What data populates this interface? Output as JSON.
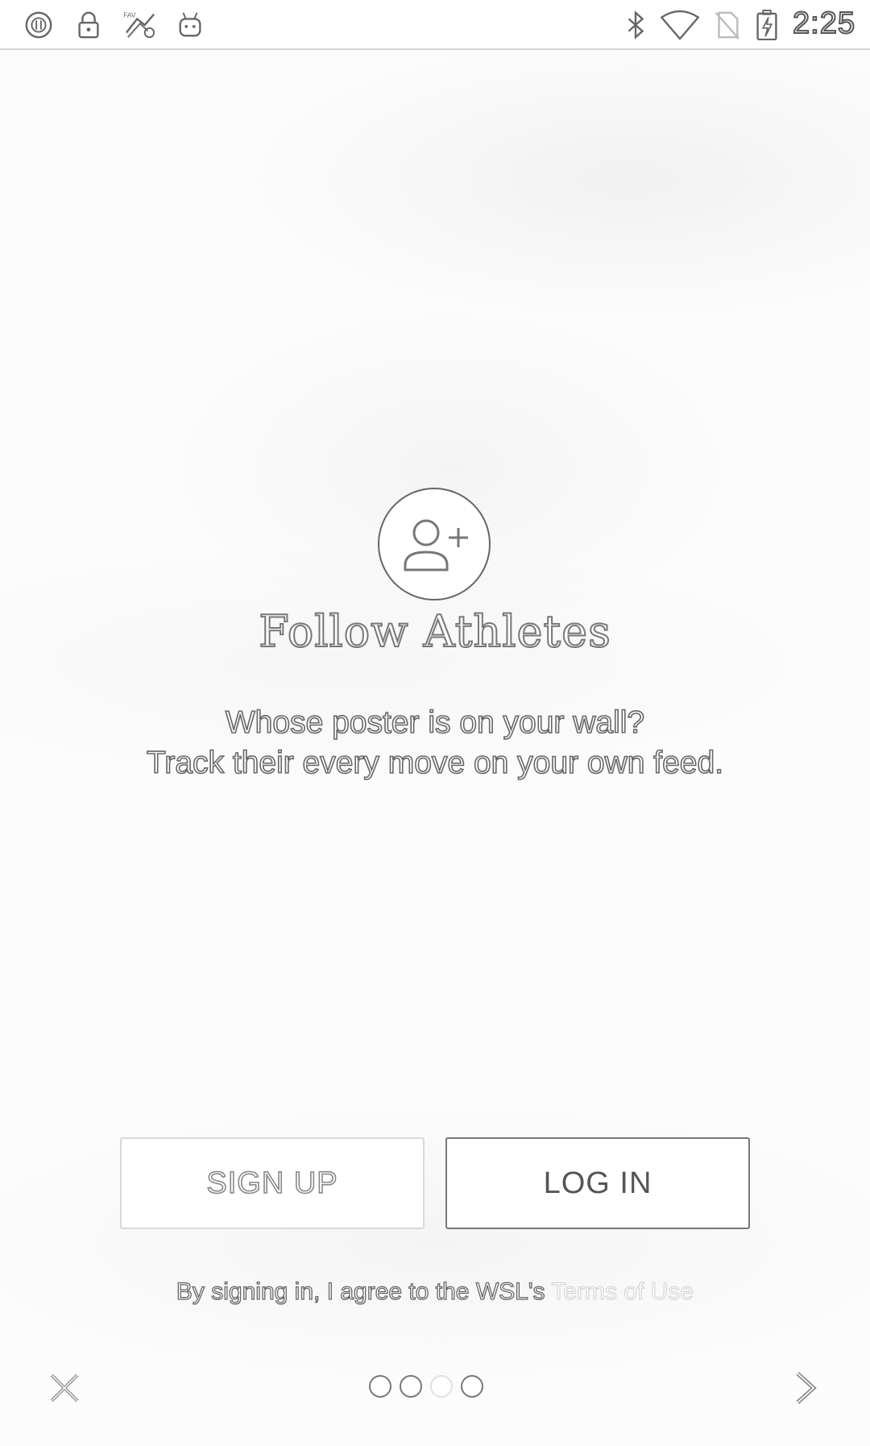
{
  "status_bar": {
    "time": "2:25",
    "left_icons": [
      "sync-icon",
      "lock-icon",
      "app-badge-icon",
      "android-icon"
    ],
    "right_icons": [
      "bluetooth-icon",
      "wifi-icon",
      "no-sim-icon",
      "battery-charging-icon"
    ]
  },
  "onboarding": {
    "icon": "add-person-icon",
    "title": "Follow Athletes",
    "subtitle_line1": "Whose poster is on your wall?",
    "subtitle_line2": "Track their every move on your own feed."
  },
  "buttons": {
    "signup_label": "SIGN UP",
    "login_label": "LOG IN"
  },
  "terms": {
    "prefix": "By signing in, I agree to the WSL's ",
    "link": "Terms of Use"
  },
  "pager": {
    "page_count": 4,
    "current_page": 3,
    "close_icon": "close-icon",
    "next_icon": "chevron-right-icon"
  }
}
